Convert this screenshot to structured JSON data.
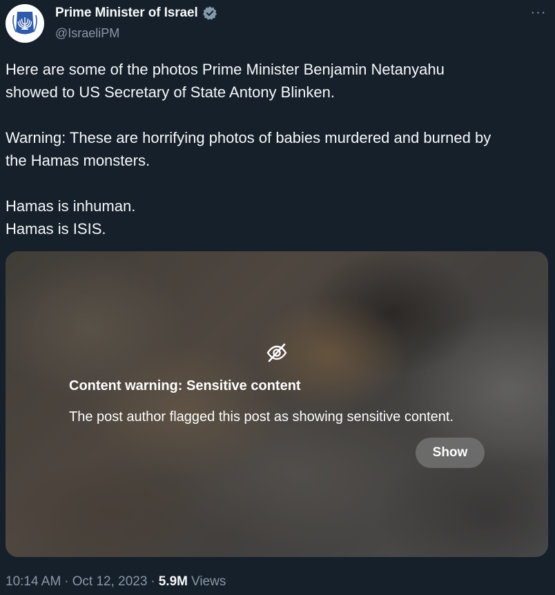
{
  "author": {
    "display_name": "Prime Minister of Israel",
    "handle": "@IsraeliPM",
    "avatar_icon": "menorah-emblem-icon",
    "verified_icon": "verified-badge-icon"
  },
  "more_icon_glyph": "···",
  "tweet": {
    "paragraphs": [
      [
        "Here are some of the photos Prime Minister Benjamin Netanyahu",
        "showed to US Secretary of State Antony Blinken."
      ],
      [
        "Warning: These are horrifying photos of babies murdered and burned by",
        "the Hamas monsters."
      ],
      [
        "Hamas is inhuman.",
        "Hamas is ISIS."
      ]
    ]
  },
  "media": {
    "warning_icon": "eye-slash-icon",
    "warning_title": "Content warning: Sensitive content",
    "warning_description": "The post author flagged this post as showing sensitive content.",
    "show_label": "Show"
  },
  "meta": {
    "time": "10:14 AM",
    "separator": "·",
    "date": "Oct 12, 2023",
    "views_count": "5.9M",
    "views_label": "Views"
  },
  "colors": {
    "background": "#15202b",
    "primary_text": "#f7f9f9",
    "secondary_text": "#8b98a5",
    "verified_badge": "#829aab"
  }
}
